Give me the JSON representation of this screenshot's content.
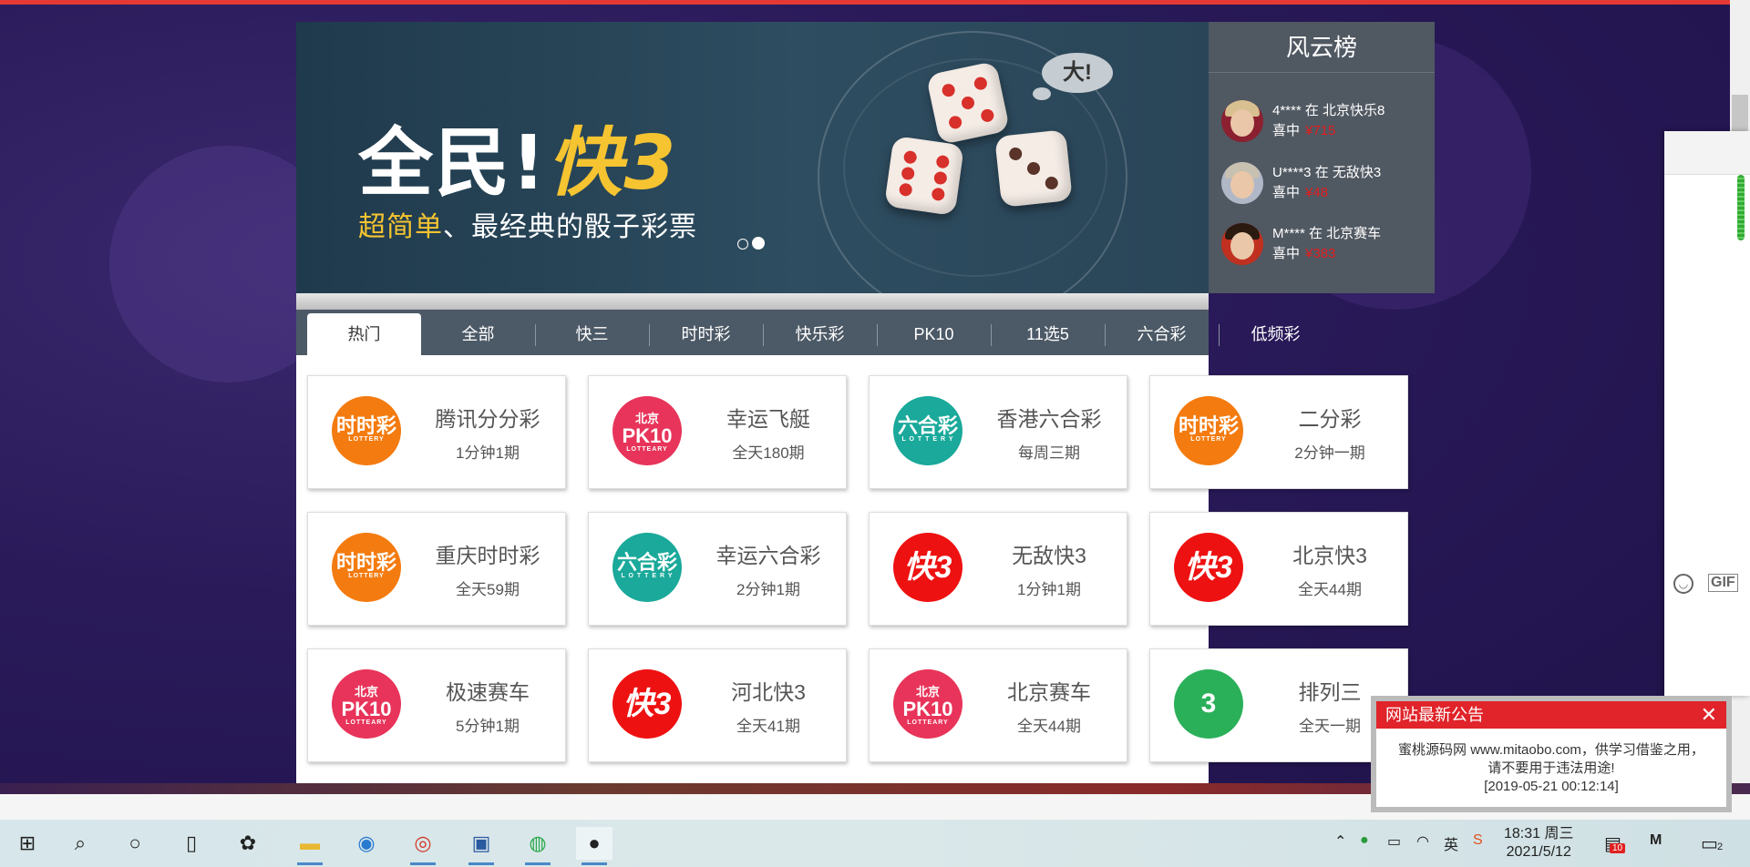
{
  "banner": {
    "title_plain": "全民!",
    "title_highlight": "快3",
    "subtitle_highlight": "超简单",
    "subtitle_rest": "、最经典的骰子彩票",
    "bubble": "大!"
  },
  "ranking": {
    "title": "风云榜",
    "items": [
      {
        "user": "4**** 在 北京快乐8",
        "won_label": "喜中",
        "amount": "¥715"
      },
      {
        "user": "U****3 在 无敌快3",
        "won_label": "喜中",
        "amount": "¥48"
      },
      {
        "user": "M**** 在 北京赛车",
        "won_label": "喜中",
        "amount": "¥383"
      }
    ]
  },
  "tabs": [
    "热门",
    "全部",
    "快三",
    "时时彩",
    "快乐彩",
    "PK10",
    "11选5",
    "六合彩",
    "低频彩"
  ],
  "games": [
    {
      "name": "腾讯分分彩",
      "freq": "1分钟1期",
      "logo": "ssc",
      "color": "#f47b0f"
    },
    {
      "name": "幸运飞艇",
      "freq": "全天180期",
      "logo": "pk10",
      "color": "#e8345a"
    },
    {
      "name": "香港六合彩",
      "freq": "每周三期",
      "logo": "lhc",
      "color": "#1aa99a"
    },
    {
      "name": "二分彩",
      "freq": "2分钟一期",
      "logo": "ssc",
      "color": "#f47b0f"
    },
    {
      "name": "重庆时时彩",
      "freq": "全天59期",
      "logo": "ssc",
      "color": "#f47b0f"
    },
    {
      "name": "幸运六合彩",
      "freq": "2分钟1期",
      "logo": "lhc",
      "color": "#1aa99a"
    },
    {
      "name": "无敌快3",
      "freq": "1分钟1期",
      "logo": "k3",
      "color": "#ee1111"
    },
    {
      "name": "北京快3",
      "freq": "全天44期",
      "logo": "k3",
      "color": "#ee1111"
    },
    {
      "name": "极速赛车",
      "freq": "5分钟1期",
      "logo": "pk10",
      "color": "#e8345a"
    },
    {
      "name": "河北快3",
      "freq": "全天41期",
      "logo": "k3",
      "color": "#ee1111"
    },
    {
      "name": "北京赛车",
      "freq": "全天44期",
      "logo": "pk10",
      "color": "#e8345a"
    },
    {
      "name": "排列三",
      "freq": "全天一期",
      "logo": "pl3",
      "color": "#2bb05a"
    }
  ],
  "logo_text": {
    "ssc": {
      "t1": "",
      "t2": "时时彩",
      "t3": "LOTTERY"
    },
    "pk10": {
      "t1": "北京",
      "t2": "PK10",
      "t3": "LOTTEARY"
    },
    "lhc": {
      "t1": "",
      "t2": "六合彩",
      "t3": "L O T T E R Y"
    },
    "k3": {
      "big": "快3"
    },
    "pl3": {
      "big": "3"
    }
  },
  "notice": {
    "title": "网站最新公告",
    "close": "✕",
    "line1": "蜜桃源码网 www.mitaobo.com，供学习借鉴之用，",
    "line2": "请不要用于违法用途!",
    "time": "[2019-05-21 00:12:14]"
  },
  "side_panel": {
    "gif_label": "GIF"
  },
  "taskbar": {
    "time": "18:31 周三",
    "date": "2021/5/12",
    "notif_count": "10",
    "msg_count": "2",
    "ime": "英"
  }
}
